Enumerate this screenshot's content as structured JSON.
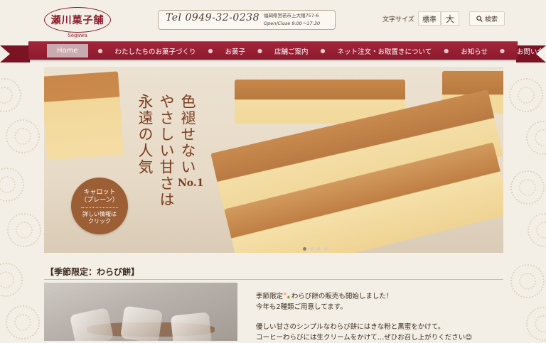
{
  "header": {
    "logo_text": "瀬川菓子舗",
    "logo_sub": "Segawa",
    "phone": "Tel 0949-32-0238",
    "address": "福岡県宮若市上大隈757-6",
    "hours": "Open/Close 9:00〜17:30",
    "font_size_label": "文字サイズ",
    "font_size_normal": "標準",
    "font_size_large": "大",
    "search_label": "検索"
  },
  "nav": {
    "items": [
      {
        "label": "Home",
        "active": true
      },
      {
        "label": "わたしたちのお菓子づくり"
      },
      {
        "label": "お菓子"
      },
      {
        "label": "店舗ご案内"
      },
      {
        "label": "ネット注文・お取置きについて"
      },
      {
        "label": "お知らせ"
      },
      {
        "label": "お問い合わせ"
      }
    ]
  },
  "hero": {
    "line1": "色褪せない",
    "line2": "やさしい甘さは",
    "line3": "永遠の人気",
    "rank": "No.1",
    "badge_title": "キャロット\n（プレーン）",
    "badge_link": "詳しい情報は\nクリック",
    "slide_count": 4,
    "active_slide": 1
  },
  "seasonal": {
    "title": "【季節限定：わらび餅】",
    "lines": [
      "季節限定🍡わらび餅の販売も開始しました！",
      "今年も2種類ご用意してます。",
      "",
      "優しい甘さのシンプルなわらび餅にはきな粉と黒蜜をかけて。",
      "コーヒーわらびには生クリームをかけて…ぜひお召し上がりください😊"
    ]
  },
  "colors": {
    "brand": "#8b1a2e",
    "accent": "#9c5e34",
    "background": "#f4efe6"
  }
}
